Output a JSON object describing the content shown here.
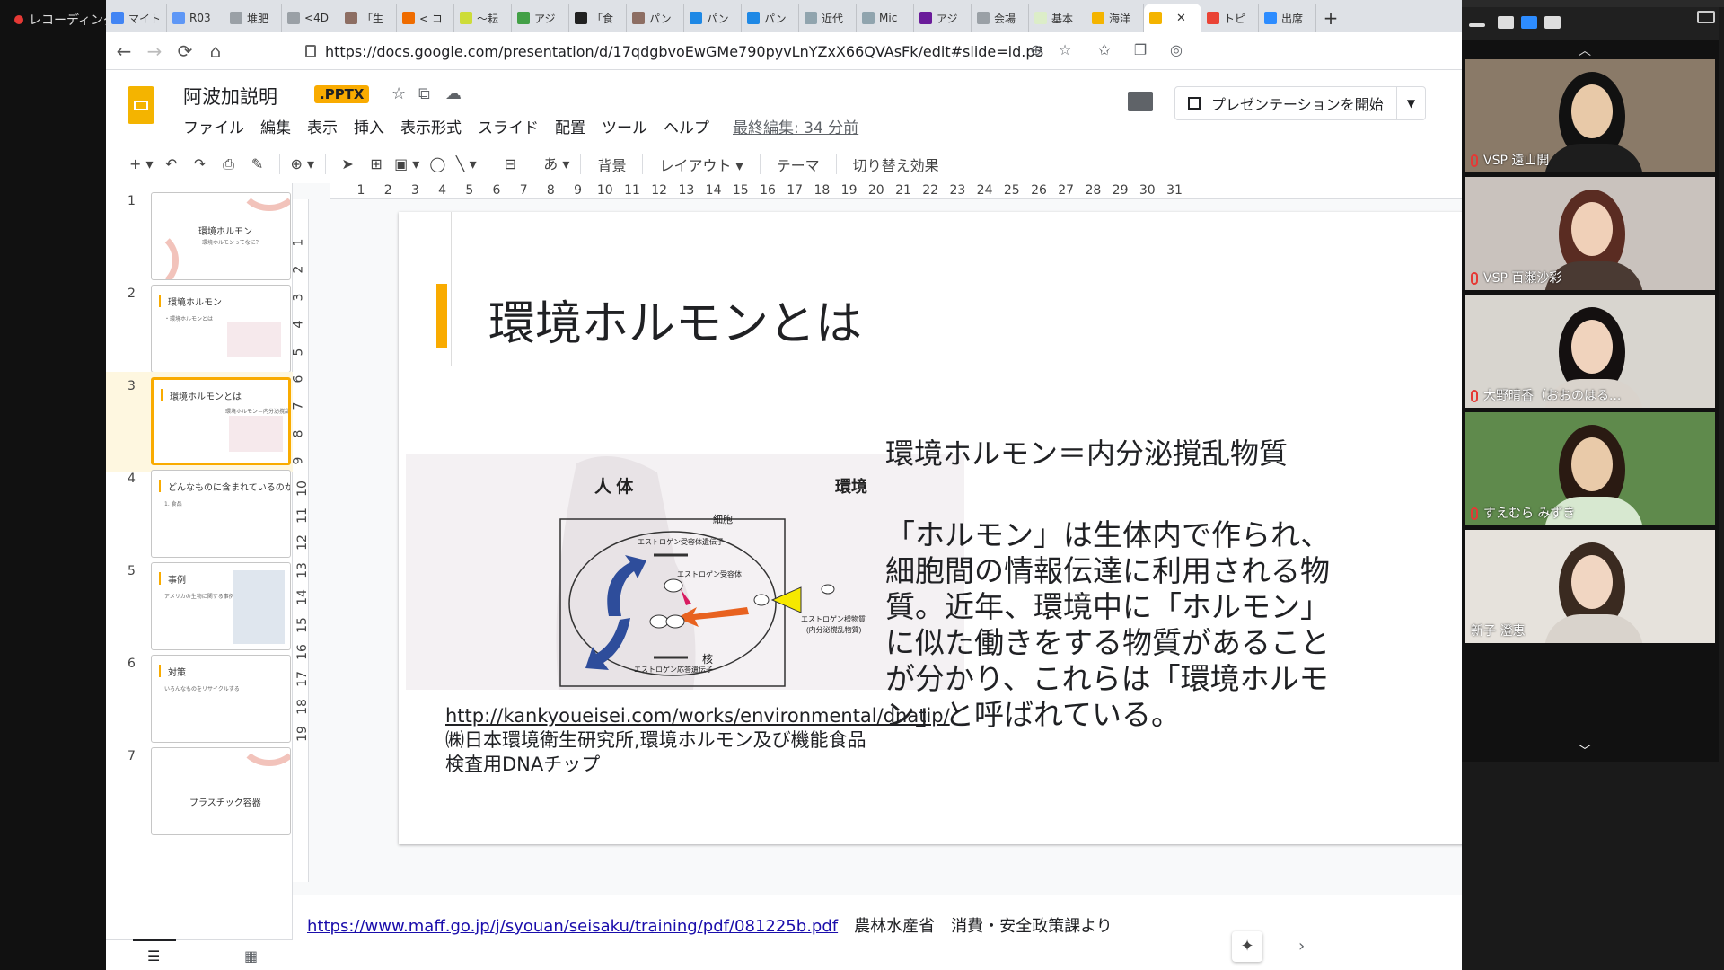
{
  "recorder": {
    "label": "レコーディング"
  },
  "browser": {
    "tabs": [
      {
        "label": "マイト",
        "color": "#4285f4"
      },
      {
        "label": "R03",
        "color": "#5e97f6"
      },
      {
        "label": "堆肥",
        "color": "#9aa0a6"
      },
      {
        "label": "<4D",
        "color": "#9aa0a6"
      },
      {
        "label": "「生",
        "color": "#8d6e63"
      },
      {
        "label": "< コ",
        "color": "#ef6c00"
      },
      {
        "label": "〜耘",
        "color": "#cddc39"
      },
      {
        "label": "アジ",
        "color": "#43a047"
      },
      {
        "label": "「食",
        "color": "#212121"
      },
      {
        "label": "パン",
        "color": "#8d6e63"
      },
      {
        "label": "パン",
        "color": "#1e88e5"
      },
      {
        "label": "パン",
        "color": "#1e88e5"
      },
      {
        "label": "近代",
        "color": "#90a4ae"
      },
      {
        "label": "Mic",
        "color": "#90a4ae"
      },
      {
        "label": "アジ",
        "color": "#6a1b9a"
      },
      {
        "label": "会場",
        "color": "#9aa0a6"
      },
      {
        "label": "基本",
        "color": "#dcedc8"
      },
      {
        "label": "海洋",
        "color": "#f4b400"
      },
      {
        "label": "",
        "color": "#f4b400",
        "active": true
      },
      {
        "label": "トピ",
        "color": "#ea4335"
      },
      {
        "label": "出席",
        "color": "#2d8cff"
      }
    ],
    "close_glyph": "✕",
    "newtab_glyph": "+",
    "url": "https://docs.google.com/presentation/d/17qdgbvoEwGMe790pyvLnYZxX66QVAsFk/edit#slide=id.p3"
  },
  "app": {
    "doc_title": "阿波加説明",
    "badge": ".PPTX",
    "menus": [
      "ファイル",
      "編集",
      "表示",
      "挿入",
      "表示形式",
      "スライド",
      "配置",
      "ツール",
      "ヘルプ"
    ],
    "last_edit": "最終編集: 34 分前",
    "present_label": "プレゼンテーションを開始",
    "toolbar_text": [
      "背景",
      "レイアウト",
      "テーマ",
      "切り替え効果"
    ],
    "text_style_glyph": "あ"
  },
  "filmstrip": {
    "slides": [
      {
        "num": "1",
        "title": "環境ホルモン",
        "sub": "環境ホルモンってなに？"
      },
      {
        "num": "2",
        "title": "環境ホルモン",
        "sub": "・環境ホルモンとは"
      },
      {
        "num": "3",
        "title": "環境ホルモンとは",
        "sub": "環境ホルモン＝内分泌撹乱物質",
        "selected": true
      },
      {
        "num": "4",
        "title": "どんなものに含まれているのか",
        "sub": "1. 食品"
      },
      {
        "num": "5",
        "title": "事例",
        "sub": "アメリカの生物に関する事例"
      },
      {
        "num": "6",
        "title": "対策",
        "sub": "いろんなものをリサイクルする"
      },
      {
        "num": "7",
        "title": "プラスチック容器",
        "sub": ""
      }
    ]
  },
  "ruler": {
    "h": [
      "1",
      "2",
      "3",
      "4",
      "5",
      "6",
      "7",
      "8",
      "9",
      "10",
      "11",
      "12",
      "13",
      "14",
      "15",
      "16",
      "17",
      "18",
      "19",
      "20",
      "21",
      "22",
      "23",
      "24",
      "25",
      "26",
      "27",
      "28",
      "29",
      "30",
      "31"
    ],
    "v": [
      "1",
      "2",
      "3",
      "4",
      "5",
      "6",
      "7",
      "8",
      "9",
      "10",
      "11",
      "12",
      "13",
      "14",
      "15",
      "16",
      "17",
      "18",
      "19"
    ]
  },
  "slide": {
    "title": "環境ホルモンとは",
    "subhead": "環境ホルモン＝内分泌撹乱物質",
    "body": "「ホルモン」は生体内で作られ、細胞間の情報伝達に利用される物質。近年、環境中に「ホルモン」に似た働きをする物質があることが分かり、これらは「環境ホルモン」と呼ばれている。",
    "citation_link": "http://kankyoueisei.com/works/environmental/dnatip/",
    "citation_text": "㈱日本環境衛生研究所,環境ホルモン及び機能食品　検査用DNAチップ",
    "diagram": {
      "human": "人 体",
      "env": "環境",
      "cell": "細胞",
      "receptor_gene": "エストロゲン受容体遺伝子",
      "receptor": "エストロゲン受容体",
      "nucleus": "核",
      "response_gene": "エストロゲン応答遺伝子",
      "mimic": "エストロゲン様物質",
      "mimic_sub": "(内分泌撹乱物質)"
    }
  },
  "notes": {
    "link": "https://www.maff.go.jp/j/syouan/seisaku/training/pdf/081225b.pdf",
    "text": "農林水産省　消費・安全政策課より"
  },
  "zoom": {
    "participants": [
      {
        "name": "VSP 遠山開",
        "bg": "#8a7a68",
        "muted": true
      },
      {
        "name": "VSP 百瀬沙彩",
        "bg": "#c9c2bd",
        "muted": true
      },
      {
        "name": "大野晴香（おおのはる...",
        "bg": "#d8d5cf",
        "muted": true
      },
      {
        "name": "すえむら みずき",
        "bg": "#5f8a4c",
        "muted": true
      },
      {
        "name": "新子 澄恵",
        "bg": "#e6e2dc",
        "muted": false
      }
    ]
  }
}
